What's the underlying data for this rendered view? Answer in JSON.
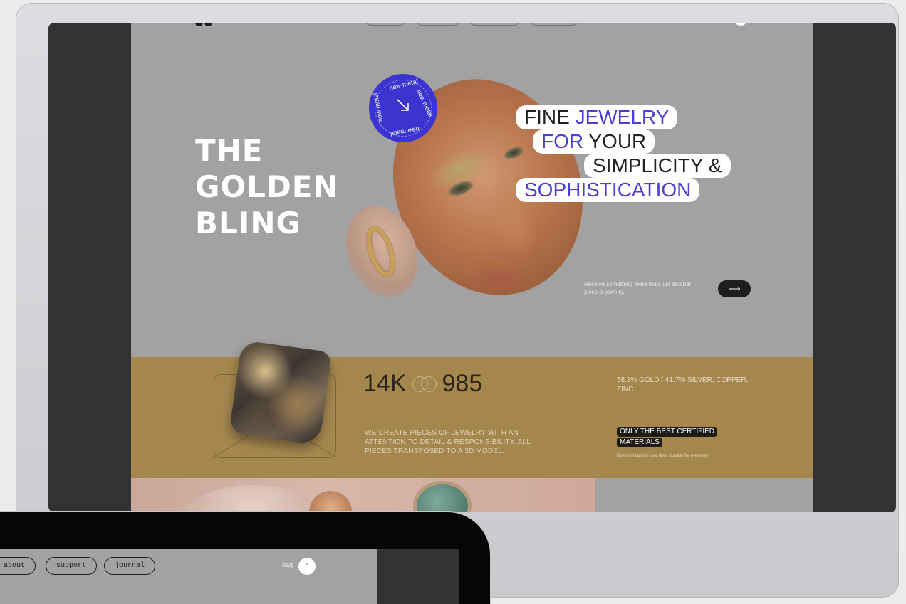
{
  "hero": {
    "title_lines": [
      "THE",
      "GOLDEN",
      "BLING"
    ],
    "badge_text": "new metal",
    "tagline": {
      "line1_a": "FINE ",
      "line1_b": "JEWELRY",
      "line2_a": "FOR",
      "line2_b": " YOUR",
      "line3": "SIMPLICITY &",
      "line4": "SOPHISTICATION"
    },
    "receive_text": "Receive something more than just another piece of jewelry..",
    "cta_icon": "arrow-right-icon"
  },
  "material": {
    "karat_left": "14K",
    "karat_right": "985",
    "description": "WE CREATE PIECES OF JEWELRY WITH AN ATTENTION TO DETAIL & RESPONSIBILITY. ALL PIECES TRANSPOSED TO A 3D MODEL.",
    "composition": "58.3% GOLD / 41.7% SILVER, COPPER, ZINC",
    "cert_line1": "ONLY THE BEST CERTIFIED",
    "cert_line2": "MATERIALS",
    "cert_note": "Does not tarnish over time, durable for everyday"
  },
  "laptop_nav": {
    "items": [
      "about",
      "support",
      "journal"
    ],
    "bag_label": "bag",
    "bag_count": "0"
  },
  "colors": {
    "accent": "#3b34d1",
    "site_bg": "#a2a2a2",
    "band_gold": "#a5874e",
    "dark": "#1e1e1e"
  }
}
